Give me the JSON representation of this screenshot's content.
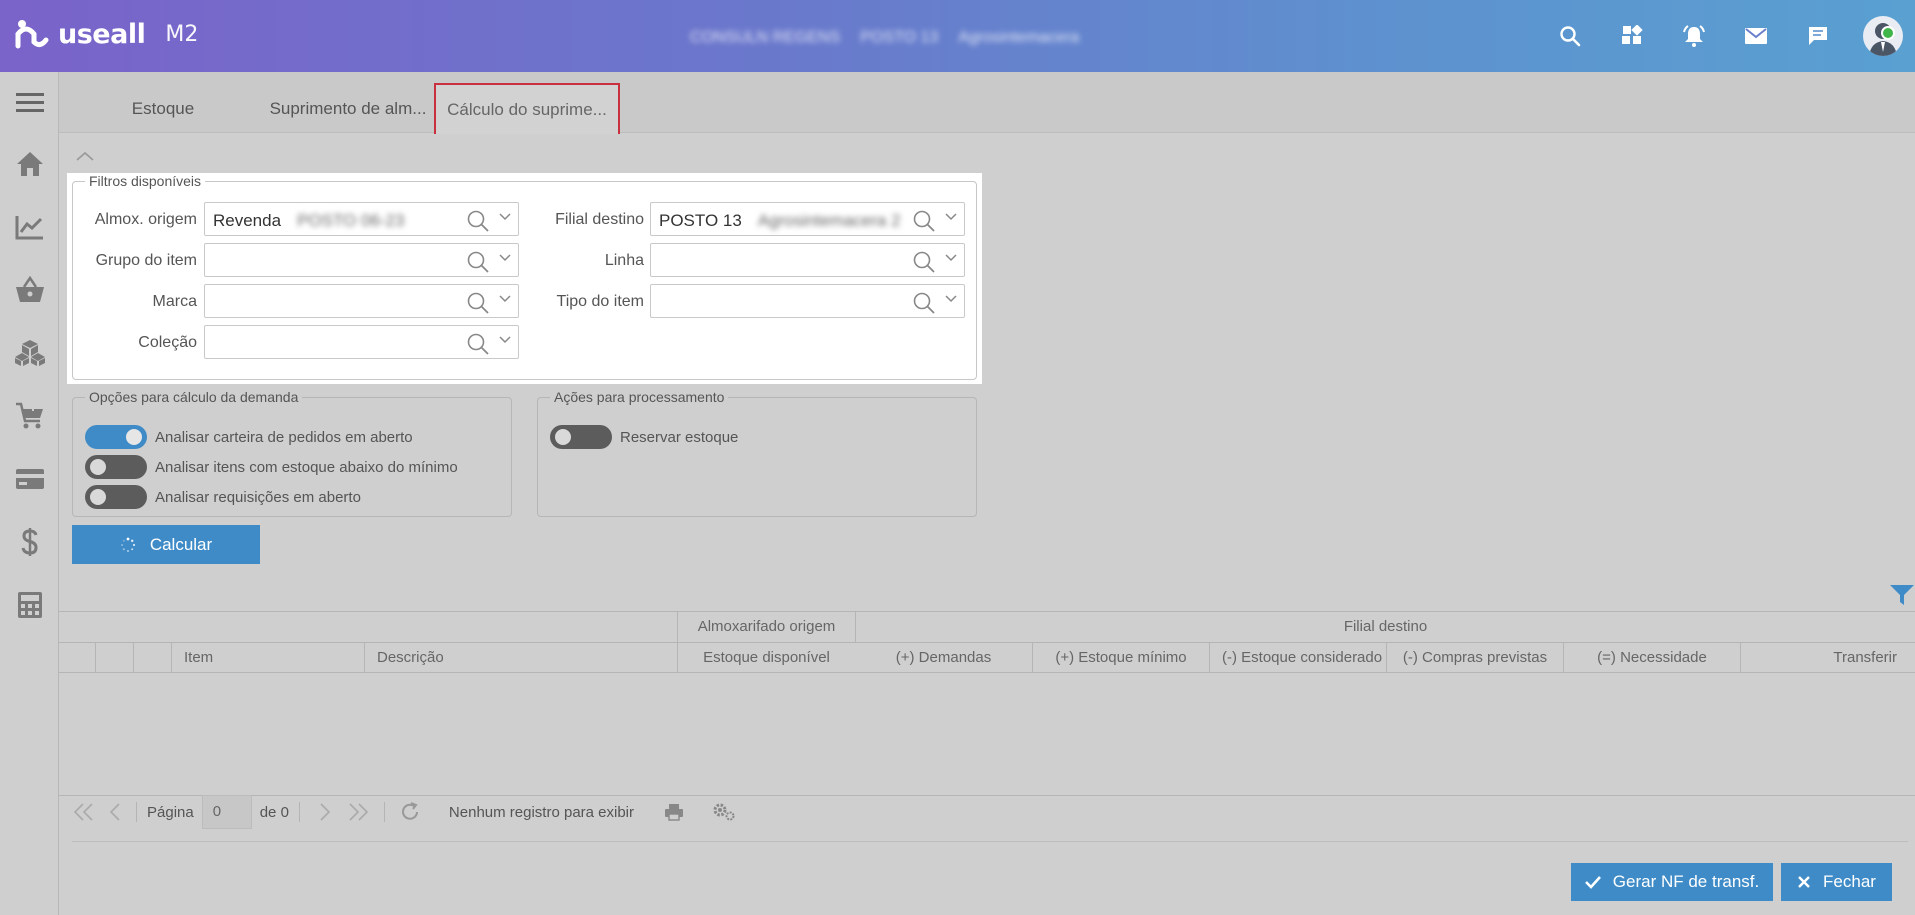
{
  "app": {
    "logo_word": "useall",
    "logo_version": "M2"
  },
  "header": {
    "context": [
      "CONSULN REGENS",
      "POSTO 13",
      "Agrosintemacera"
    ]
  },
  "tabs": [
    {
      "label": "Estoque"
    },
    {
      "label": "Suprimento de alm..."
    },
    {
      "label": "Cálculo do suprime..."
    }
  ],
  "filters": {
    "legend": "Filtros disponíveis",
    "almox_origem": {
      "label": "Almox. origem",
      "value": "Revenda",
      "value_extra": "POSTO 06-23"
    },
    "grupo_item": {
      "label": "Grupo do item",
      "value": ""
    },
    "marca": {
      "label": "Marca",
      "value": ""
    },
    "colecao": {
      "label": "Coleção",
      "value": ""
    },
    "filial_destino": {
      "label": "Filial destino",
      "value": "POSTO 13",
      "value_extra": "Agrosintemacera 2"
    },
    "linha": {
      "label": "Linha",
      "value": ""
    },
    "tipo_item": {
      "label": "Tipo do item",
      "value": ""
    }
  },
  "options": {
    "legend": "Opções para cálculo da demanda",
    "items": [
      {
        "label": "Analisar carteira de pedidos em aberto",
        "on": true
      },
      {
        "label": "Analisar itens com estoque abaixo do mínimo",
        "on": false
      },
      {
        "label": "Analisar requisições em aberto",
        "on": false
      }
    ]
  },
  "actions": {
    "legend": "Ações para processamento",
    "items": [
      {
        "label": "Reservar estoque",
        "on": false
      }
    ]
  },
  "calc_button": {
    "label": "Calcular"
  },
  "grid": {
    "group_headers": [
      "Almoxarifado origem",
      "Filial destino"
    ],
    "columns": [
      "Item",
      "Descrição",
      "Estoque disponível",
      "(+) Demandas",
      "(+) Estoque mínimo",
      "(-) Estoque considerado",
      "(-) Compras previstas",
      "(=) Necessidade",
      "Transferir"
    ]
  },
  "pager": {
    "page_label": "Página",
    "page_value": "0",
    "of_label": "de 0",
    "status": "Nenhum registro para exibir"
  },
  "footer": {
    "gerar_label": "Gerar NF de transf.",
    "fechar_label": "Fechar"
  },
  "colors": {
    "accent": "#3e8bc7",
    "active_tab_border": "#c9303f",
    "header_start": "#7a63c9",
    "header_end": "#5aa0d1"
  }
}
